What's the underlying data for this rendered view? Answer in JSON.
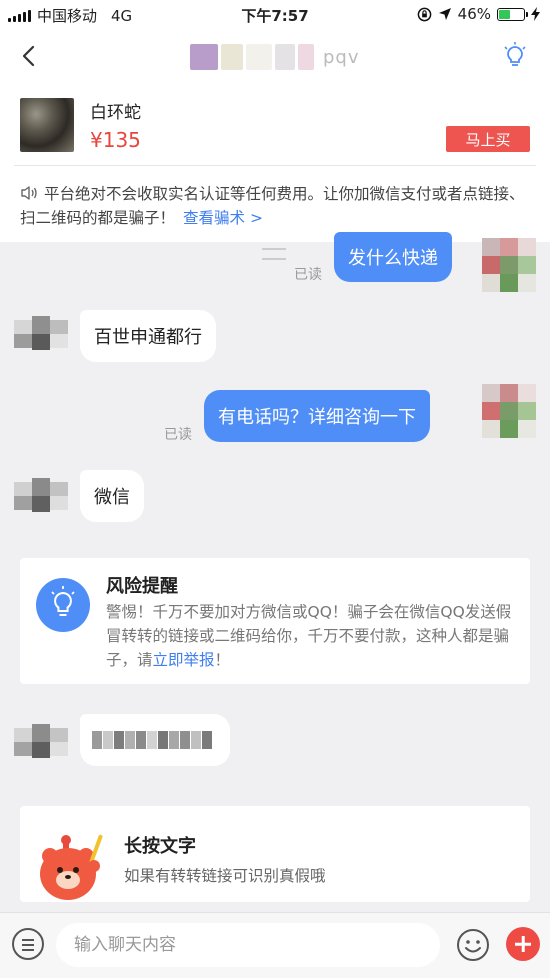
{
  "status_bar": {
    "carrier": "中国移动",
    "network": "4G",
    "time": "下午7:57",
    "battery": "46%",
    "battery_level": 0.46
  },
  "nav": {
    "title_visible": "pqv"
  },
  "product": {
    "name": "白环蛇",
    "price": "¥135",
    "buy_label": "马上买"
  },
  "warning": {
    "text": "平台绝对不会收取实名认证等任何费用。让你加微信支付或者点链接、扫二维码的都是骗子！",
    "link": "查看骗术 >"
  },
  "messages": [
    {
      "side": "out",
      "text": "发什么快递",
      "status": "已读"
    },
    {
      "side": "in",
      "text": "百世申通都行"
    },
    {
      "side": "out",
      "text": "有电话吗？详细咨询一下",
      "status": "已读"
    },
    {
      "side": "in",
      "text": "微信"
    },
    {
      "side": "in",
      "text": "pixelated-number"
    }
  ],
  "risk": {
    "title": "风险提醒",
    "body": "警惕！千万不要加对方微信或QQ！骗子会在微信QQ发送假冒转转的链接或二维码给你，千万不要付款，这种人都是骗子，请",
    "link": "立即举报",
    "tail": "！"
  },
  "tip": {
    "title": "长按文字",
    "body": "如果有转转链接可识别真假哦"
  },
  "input": {
    "placeholder": "输入聊天内容"
  },
  "colors": {
    "accent": "#4f8ef7",
    "danger": "#ee5550",
    "link": "#3f7ef0"
  }
}
